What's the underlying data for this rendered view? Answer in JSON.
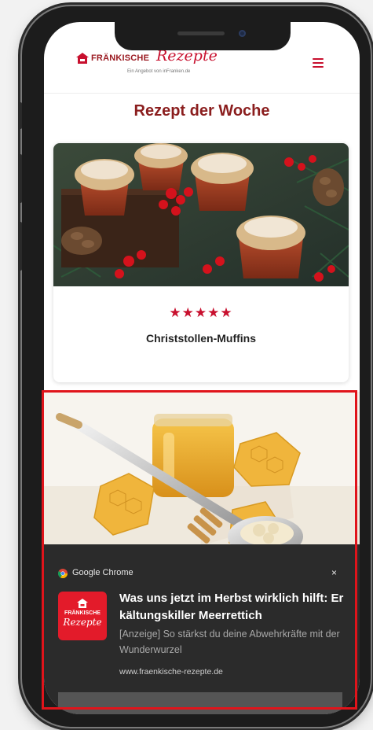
{
  "header": {
    "logo_brand": "FRÄNKISCHE",
    "logo_script": "Rezepte",
    "logo_tagline": "Ein Angebot von inFranken.de"
  },
  "section_title": "Rezept der Woche",
  "recipe": {
    "rating_stars": "★★★★★",
    "rating": 5,
    "title": "Christstollen-Muffins"
  },
  "notification": {
    "app_name": "Google Chrome",
    "close_glyph": "×",
    "logo_brand": "FRÄNKISCHE",
    "logo_script": "Rezepte",
    "title": "Was uns jetzt im Herbst wirklich hilft: Erkältungskiller Meerrettich",
    "body": "[Anzeige] So stärkst du deine Abwehrkräfte mit der Wunderwurzel",
    "url": "www.fraenkische-rezepte.de"
  },
  "colors": {
    "brand_red": "#c8102e",
    "title_red": "#8b1e1e",
    "highlight_red": "#e0141b",
    "notification_bg": "#2b2b2b"
  }
}
